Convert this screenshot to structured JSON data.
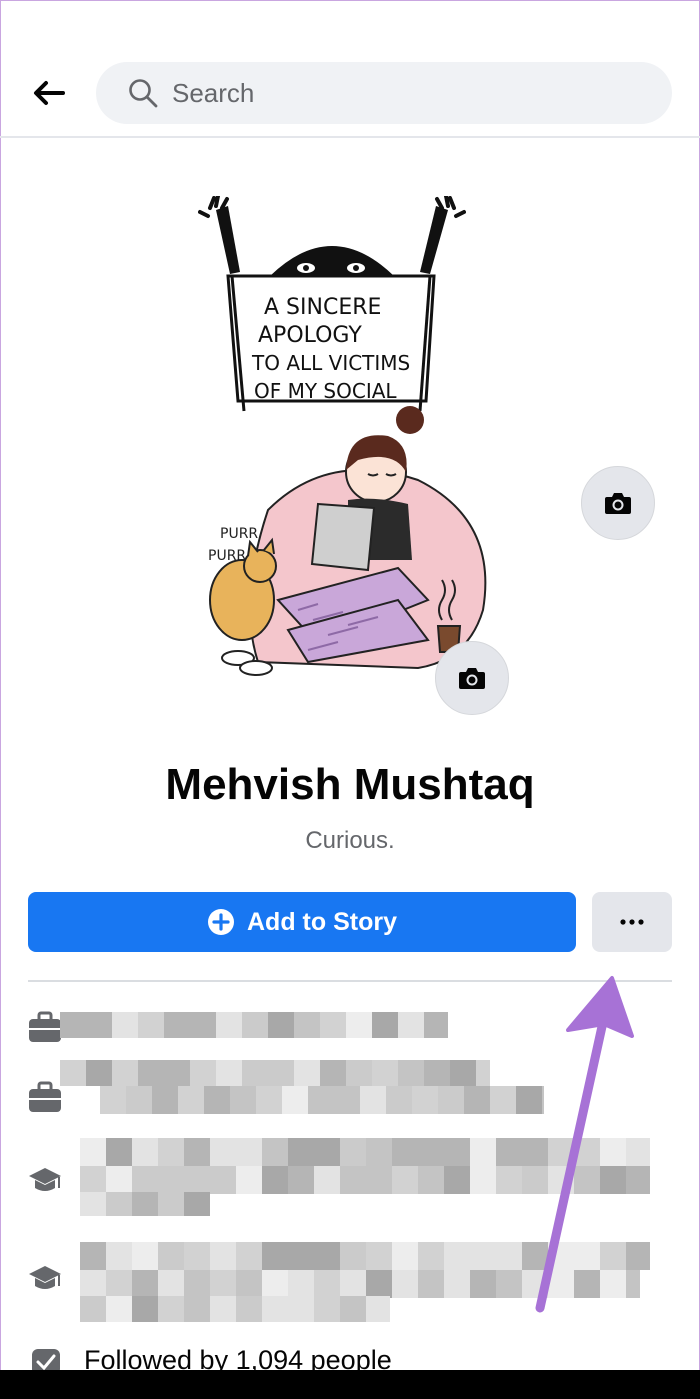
{
  "header": {
    "back_icon": "back-arrow-icon",
    "search_placeholder": "Search"
  },
  "cover": {
    "camera_icon": "camera-icon",
    "artwork_text": [
      "A SINCERE",
      "APOLOGY",
      "TO ALL VICTIMS",
      "OF MY SOCIAL"
    ]
  },
  "profile_picture": {
    "camera_icon": "camera-icon",
    "artwork_text": [
      "PURR",
      "PURR"
    ]
  },
  "profile": {
    "name": "Mehvish Mushtaq",
    "bio": "Curious."
  },
  "actions": {
    "add_story_label": "Add to Story",
    "more_label": "···"
  },
  "details": {
    "items": [
      {
        "icon": "briefcase-icon"
      },
      {
        "icon": "briefcase-icon"
      },
      {
        "icon": "graduation-cap-icon"
      },
      {
        "icon": "graduation-cap-icon"
      }
    ],
    "followers_text": "Followed by 1,094 people"
  },
  "colors": {
    "accent": "#1877f2",
    "annotation_arrow": "#b57edc"
  }
}
